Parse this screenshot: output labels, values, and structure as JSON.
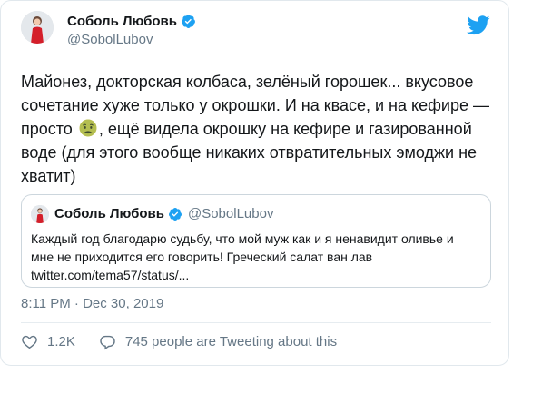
{
  "author": {
    "name": "Соболь Любовь",
    "handle": "@SobolLubov",
    "verified": true
  },
  "tweet": {
    "text_before_emoji": "Майонез, докторская колбаса, зелёный горошек... вкусовое сочетание хуже только у окрошки. И на квасе, и на кефире — просто ",
    "emoji": "nauseated-face",
    "text_after_emoji": ", ещё видела окрошку на кефире и газированной воде (для этого вообще никаких отвратительных эмоджи не хватит)"
  },
  "quoted_tweet": {
    "name": "Соболь Любовь",
    "handle": "@SobolLubov",
    "verified": true,
    "text": "Каждый год благодарю судьбу, что мой муж как и я ненавидит оливье и мне не приходится его говорить! Греческий салат ван лав twitter.com/tema57/status/..."
  },
  "timestamp": "8:11 PM · Dec 30, 2019",
  "stats": {
    "likes": "1.2K",
    "tweeting_about": "745 people are Tweeting about this"
  },
  "colors": {
    "twitter_blue": "#1da1f2",
    "secondary_text": "#657786",
    "border": "#e1e8ed"
  }
}
